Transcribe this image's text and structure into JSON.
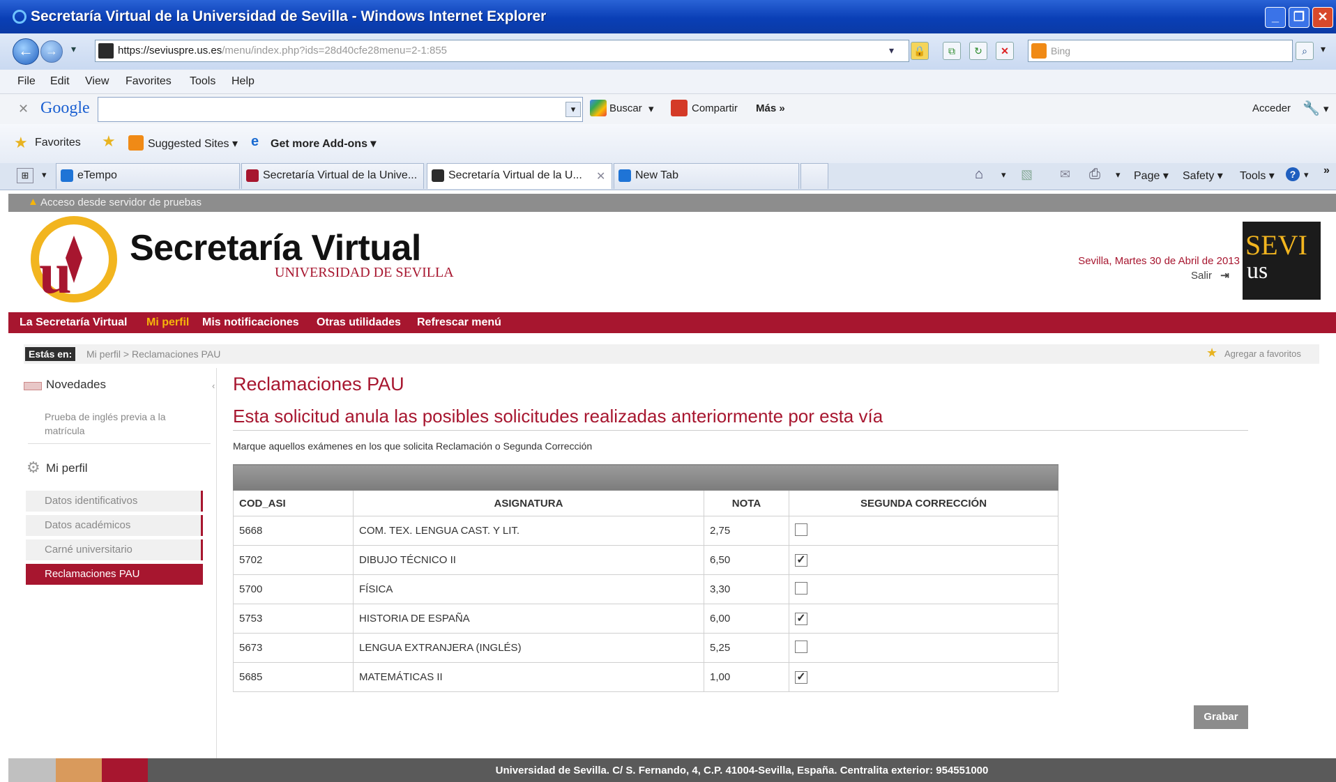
{
  "window": {
    "title": "Secretaría Virtual de la Universidad de Sevilla - Windows Internet Explorer",
    "min": "_",
    "max": "❐",
    "close": "✕"
  },
  "browser": {
    "url_host": "https://seviuspre.us.es",
    "url_path": "/menu/index.php?ids=28d40cfe28menu=2-1:855",
    "search_placeholder": "Bing",
    "menu": [
      "File",
      "Edit",
      "View",
      "Favorites",
      "Tools",
      "Help"
    ],
    "google": {
      "logo": "Google",
      "buscar": "Buscar",
      "compartir": "Compartir",
      "mas": "Más »",
      "acceder": "Acceder"
    },
    "favorites": {
      "favorites_label": "Favorites",
      "suggested": "Suggested Sites ▾",
      "addons": "Get more Add-ons ▾"
    },
    "tabs": [
      {
        "label": "eTempo"
      },
      {
        "label": "Secretaría Virtual de la Unive..."
      },
      {
        "label": "Secretaría Virtual de la U..."
      },
      {
        "label": "New Tab"
      }
    ],
    "commands": {
      "page": "Page ▾",
      "safety": "Safety ▾",
      "tools": "Tools ▾"
    }
  },
  "page": {
    "warning": "Acceso desde servidor de pruebas",
    "header": {
      "title": "Secretaría Virtual",
      "subtitle": "UNIVERSIDAD DE SEVILLA",
      "date": "Sevilla, Martes 30 de Abril de 2013",
      "logout": "Salir",
      "sevius_top": "SEVI",
      "sevius_bottom": "us"
    },
    "nav": [
      "La Secretaría Virtual",
      "Mi perfil",
      "Mis notificaciones",
      "Otras utilidades",
      "Refrescar menú"
    ],
    "breadcrumb": {
      "prefix": "Estás en:",
      "path": "Mi perfil > Reclamaciones PAU",
      "bookmark": "Agregar a favoritos"
    },
    "sidebar": {
      "news_title": "Novedades",
      "news_item": "Prueba de inglés previa a la matrícula",
      "profile_title": "Mi perfil",
      "links": [
        "Datos identificativos",
        "Datos académicos",
        "Carné universitario",
        "Reclamaciones PAU"
      ]
    },
    "main": {
      "heading": "Reclamaciones PAU",
      "notice": "Esta solicitud anula las posibles solicitudes realizadas anteriormente por esta vía",
      "instruction": "Marque aquellos exámenes en los que solicita Reclamación o Segunda Corrección",
      "columns": [
        "COD_ASI",
        "ASIGNATURA",
        "NOTA",
        "SEGUNDA CORRECCIÓN"
      ],
      "rows": [
        {
          "code": "5668",
          "subject": "COM. TEX. LENGUA CAST. Y LIT.",
          "grade": "2,75",
          "checked": false
        },
        {
          "code": "5702",
          "subject": "DIBUJO TÉCNICO II",
          "grade": "6,50",
          "checked": true
        },
        {
          "code": "5700",
          "subject": "FÍSICA",
          "grade": "3,30",
          "checked": false
        },
        {
          "code": "5753",
          "subject": "HISTORIA DE ESPAÑA",
          "grade": "6,00",
          "checked": true
        },
        {
          "code": "5673",
          "subject": "LENGUA EXTRANJERA (INGLÉS)",
          "grade": "5,25",
          "checked": false
        },
        {
          "code": "5685",
          "subject": "MATEMÁTICAS II",
          "grade": "1,00",
          "checked": true
        }
      ],
      "save": "Grabar"
    },
    "footer": "Universidad de Sevilla. C/ S. Fernando, 4, C.P. 41004-Sevilla, España. Centralita exterior: 954551000"
  },
  "colors": {
    "brand_red": "#a7162f",
    "ie_blue": "#0a3fb6"
  }
}
